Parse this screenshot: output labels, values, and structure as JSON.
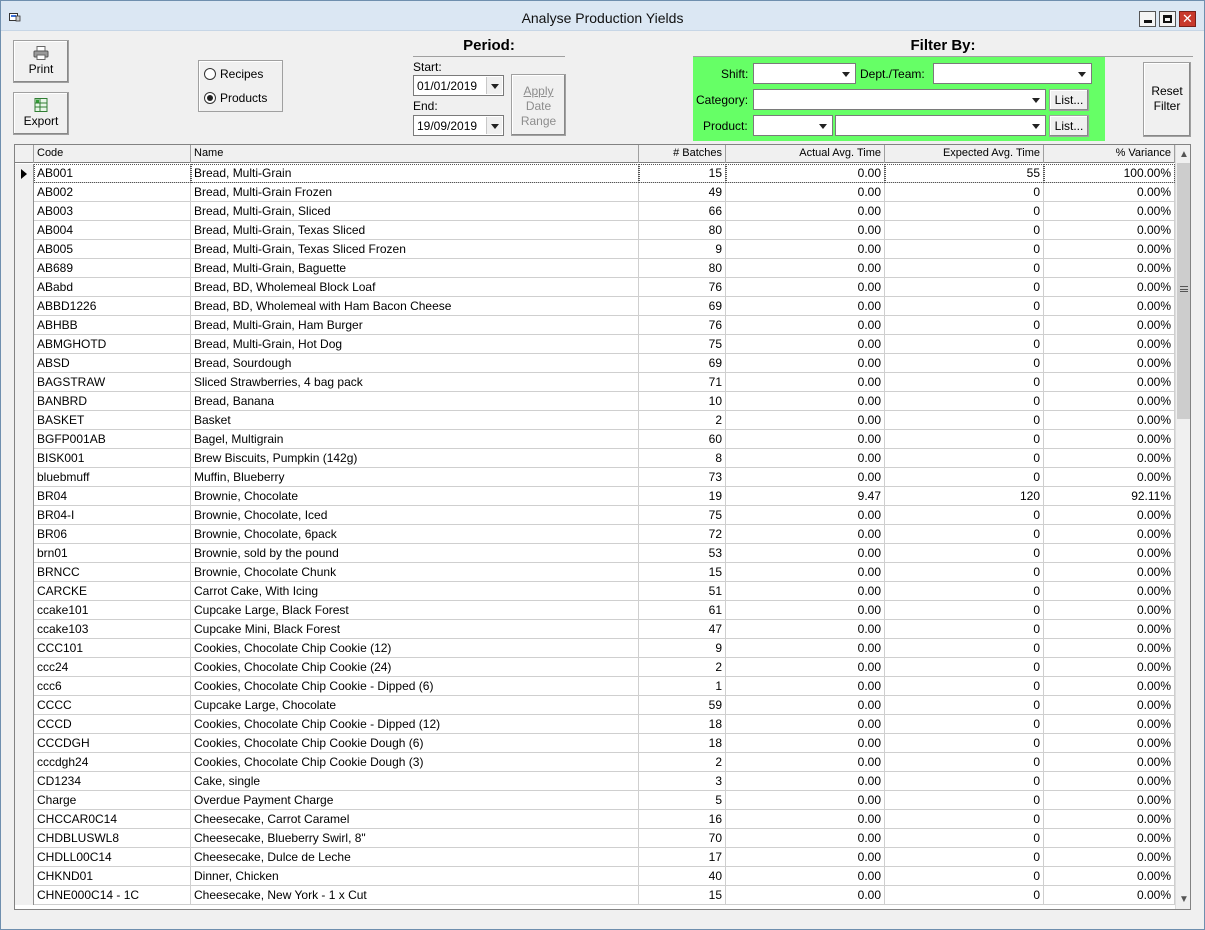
{
  "window": {
    "title": "Analyse Production Yields"
  },
  "toolbar": {
    "print_label": "Print",
    "export_label": "Export"
  },
  "mode": {
    "options": [
      {
        "label": "Recipes",
        "selected": false
      },
      {
        "label": "Products",
        "selected": true
      }
    ]
  },
  "period": {
    "title": "Period:",
    "start_label": "Start:",
    "start_value": "01/01/2019",
    "end_label": "End:",
    "end_value": "19/09/2019",
    "apply_line1": "Apply",
    "apply_line2": "Date",
    "apply_line3": "Range"
  },
  "filter": {
    "title": "Filter By:",
    "shift_label": "Shift:",
    "shift_value": "",
    "dept_label": "Dept./Team:",
    "dept_value": "",
    "category_label": "Category:",
    "category_value": "",
    "product_label": "Product:",
    "product_value": "",
    "product_value2": "",
    "list_label": "List...",
    "reset_line1": "Reset",
    "reset_line2": "Filter",
    "panel_color": "#66ff66"
  },
  "grid": {
    "columns": [
      "Code",
      "Name",
      "# Batches",
      "Actual Avg. Time",
      "Expected Avg. Time",
      "% Variance"
    ],
    "rows": [
      {
        "code": "AB001",
        "name": "Bread, Multi-Grain",
        "batches": "15",
        "actual": "0.00",
        "expected": "55",
        "variance": "100.00%"
      },
      {
        "code": "AB002",
        "name": "Bread, Multi-Grain Frozen",
        "batches": "49",
        "actual": "0.00",
        "expected": "0",
        "variance": "0.00%"
      },
      {
        "code": "AB003",
        "name": "Bread, Multi-Grain, Sliced",
        "batches": "66",
        "actual": "0.00",
        "expected": "0",
        "variance": "0.00%"
      },
      {
        "code": "AB004",
        "name": "Bread, Multi-Grain, Texas Sliced",
        "batches": "80",
        "actual": "0.00",
        "expected": "0",
        "variance": "0.00%"
      },
      {
        "code": "AB005",
        "name": "Bread, Multi-Grain, Texas Sliced Frozen",
        "batches": "9",
        "actual": "0.00",
        "expected": "0",
        "variance": "0.00%"
      },
      {
        "code": "AB689",
        "name": "Bread, Multi-Grain, Baguette",
        "batches": "80",
        "actual": "0.00",
        "expected": "0",
        "variance": "0.00%"
      },
      {
        "code": "ABabd",
        "name": "Bread, BD, Wholemeal Block Loaf",
        "batches": "76",
        "actual": "0.00",
        "expected": "0",
        "variance": "0.00%"
      },
      {
        "code": "ABBD1226",
        "name": "Bread, BD, Wholemeal with Ham Bacon Cheese",
        "batches": "69",
        "actual": "0.00",
        "expected": "0",
        "variance": "0.00%"
      },
      {
        "code": "ABHBB",
        "name": "Bread, Multi-Grain, Ham Burger",
        "batches": "76",
        "actual": "0.00",
        "expected": "0",
        "variance": "0.00%"
      },
      {
        "code": "ABMGHOTD",
        "name": "Bread, Multi-Grain, Hot Dog",
        "batches": "75",
        "actual": "0.00",
        "expected": "0",
        "variance": "0.00%"
      },
      {
        "code": "ABSD",
        "name": "Bread, Sourdough",
        "batches": "69",
        "actual": "0.00",
        "expected": "0",
        "variance": "0.00%"
      },
      {
        "code": "BAGSTRAW",
        "name": "Sliced Strawberries, 4 bag pack",
        "batches": "71",
        "actual": "0.00",
        "expected": "0",
        "variance": "0.00%"
      },
      {
        "code": "BANBRD",
        "name": "Bread, Banana",
        "batches": "10",
        "actual": "0.00",
        "expected": "0",
        "variance": "0.00%"
      },
      {
        "code": "BASKET",
        "name": "Basket",
        "batches": "2",
        "actual": "0.00",
        "expected": "0",
        "variance": "0.00%"
      },
      {
        "code": "BGFP001AB",
        "name": "Bagel, Multigrain",
        "batches": "60",
        "actual": "0.00",
        "expected": "0",
        "variance": "0.00%"
      },
      {
        "code": "BISK001",
        "name": "Brew Biscuits, Pumpkin (142g)",
        "batches": "8",
        "actual": "0.00",
        "expected": "0",
        "variance": "0.00%"
      },
      {
        "code": "bluebmuff",
        "name": "Muffin, Blueberry",
        "batches": "73",
        "actual": "0.00",
        "expected": "0",
        "variance": "0.00%"
      },
      {
        "code": "BR04",
        "name": "Brownie, Chocolate",
        "batches": "19",
        "actual": "9.47",
        "expected": "120",
        "variance": "92.11%"
      },
      {
        "code": "BR04-I",
        "name": "Brownie, Chocolate, Iced",
        "batches": "75",
        "actual": "0.00",
        "expected": "0",
        "variance": "0.00%"
      },
      {
        "code": "BR06",
        "name": "Brownie, Chocolate, 6pack",
        "batches": "72",
        "actual": "0.00",
        "expected": "0",
        "variance": "0.00%"
      },
      {
        "code": "brn01",
        "name": "Brownie, sold by the pound",
        "batches": "53",
        "actual": "0.00",
        "expected": "0",
        "variance": "0.00%"
      },
      {
        "code": "BRNCC",
        "name": "Brownie, Chocolate Chunk",
        "batches": "15",
        "actual": "0.00",
        "expected": "0",
        "variance": "0.00%"
      },
      {
        "code": "CARCKE",
        "name": "Carrot Cake, With Icing",
        "batches": "51",
        "actual": "0.00",
        "expected": "0",
        "variance": "0.00%"
      },
      {
        "code": "ccake101",
        "name": "Cupcake Large, Black Forest",
        "batches": "61",
        "actual": "0.00",
        "expected": "0",
        "variance": "0.00%"
      },
      {
        "code": "ccake103",
        "name": "Cupcake Mini, Black Forest",
        "batches": "47",
        "actual": "0.00",
        "expected": "0",
        "variance": "0.00%"
      },
      {
        "code": "CCC101",
        "name": "Cookies, Chocolate Chip Cookie (12)",
        "batches": "9",
        "actual": "0.00",
        "expected": "0",
        "variance": "0.00%"
      },
      {
        "code": "ccc24",
        "name": "Cookies, Chocolate Chip Cookie (24)",
        "batches": "2",
        "actual": "0.00",
        "expected": "0",
        "variance": "0.00%"
      },
      {
        "code": "ccc6",
        "name": "Cookies, Chocolate Chip Cookie - Dipped (6)",
        "batches": "1",
        "actual": "0.00",
        "expected": "0",
        "variance": "0.00%"
      },
      {
        "code": "CCCC",
        "name": "Cupcake Large, Chocolate",
        "batches": "59",
        "actual": "0.00",
        "expected": "0",
        "variance": "0.00%"
      },
      {
        "code": "CCCD",
        "name": "Cookies, Chocolate Chip Cookie - Dipped (12)",
        "batches": "18",
        "actual": "0.00",
        "expected": "0",
        "variance": "0.00%"
      },
      {
        "code": "CCCDGH",
        "name": "Cookies, Chocolate Chip Cookie Dough (6)",
        "batches": "18",
        "actual": "0.00",
        "expected": "0",
        "variance": "0.00%"
      },
      {
        "code": "cccdgh24",
        "name": "Cookies, Chocolate Chip Cookie Dough (3)",
        "batches": "2",
        "actual": "0.00",
        "expected": "0",
        "variance": "0.00%"
      },
      {
        "code": "CD1234",
        "name": "Cake, single",
        "batches": "3",
        "actual": "0.00",
        "expected": "0",
        "variance": "0.00%"
      },
      {
        "code": "Charge",
        "name": "Overdue Payment Charge",
        "batches": "5",
        "actual": "0.00",
        "expected": "0",
        "variance": "0.00%"
      },
      {
        "code": "CHCCAR0C14",
        "name": "Cheesecake, Carrot Caramel",
        "batches": "16",
        "actual": "0.00",
        "expected": "0",
        "variance": "0.00%"
      },
      {
        "code": "CHDBLUSWL8",
        "name": "Cheesecake, Blueberry Swirl, 8\"",
        "batches": "70",
        "actual": "0.00",
        "expected": "0",
        "variance": "0.00%"
      },
      {
        "code": "CHDLL00C14",
        "name": "Cheesecake, Dulce de Leche",
        "batches": "17",
        "actual": "0.00",
        "expected": "0",
        "variance": "0.00%"
      },
      {
        "code": "CHKND01",
        "name": "Dinner, Chicken",
        "batches": "40",
        "actual": "0.00",
        "expected": "0",
        "variance": "0.00%"
      },
      {
        "code": "CHNE000C14 - 1C",
        "name": "Cheesecake, New York - 1 x Cut",
        "batches": "15",
        "actual": "0.00",
        "expected": "0",
        "variance": "0.00%"
      }
    ]
  }
}
